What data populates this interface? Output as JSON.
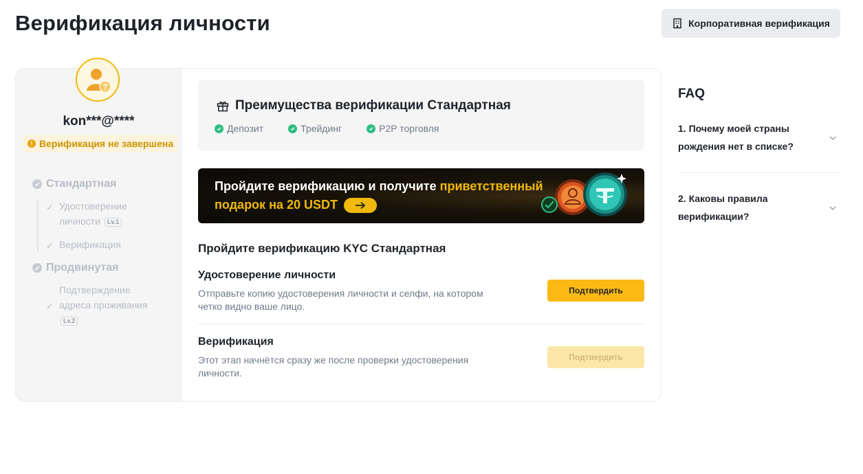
{
  "header": {
    "title": "Верификация личности",
    "corporate_button": "Корпоративная верификация"
  },
  "sidebar": {
    "username": "kon***@****",
    "status": "Верификация не завершена",
    "levels": [
      {
        "label": "Стандартная",
        "steps": [
          {
            "lines": [
              "Удостоверение",
              "личности"
            ],
            "badge": "Lv.1"
          },
          {
            "lines": [
              "Верификация"
            ]
          }
        ]
      },
      {
        "label": "Продвинутая",
        "steps": [
          {
            "lines": [
              "Подтверждение",
              "адреса проживания"
            ],
            "badge": "Lv.2"
          }
        ]
      }
    ]
  },
  "benefits": {
    "title": "Преимущества верификации Стандартная",
    "items": [
      "Депозит",
      "Трейдинг",
      "P2P торговля"
    ]
  },
  "banner": {
    "text_before": "Пройдите верификацию и получите ",
    "highlight": "приветственный подарок на 20 USDT"
  },
  "kyc": {
    "title": "Пройдите верификацию KYC Стандартная",
    "rows": [
      {
        "title": "Удостоверение личности",
        "desc": "Отправьте копию удостоверения личности и селфи, на котором четко видно ваше лицо.",
        "button": "Подтвердить"
      },
      {
        "title": "Верификация",
        "desc": "Этот этап начнётся сразу же после проверки удостоверения личности.",
        "button": "Подтвердить"
      }
    ]
  },
  "faq": {
    "title": "FAQ",
    "items": [
      "1. Почему моей страны рождения нет в списке?",
      "2. Каковы правила верификации?"
    ]
  },
  "colors": {
    "accent": "#fcb813",
    "accent_disabled": "#fbe7a8",
    "success": "#2ebd85",
    "warning": "#e8a40c"
  }
}
